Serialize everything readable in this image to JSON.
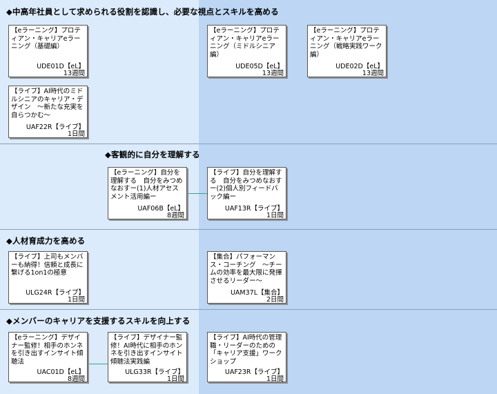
{
  "sections": [
    {
      "title": "◆中高年社員として求められる役割を認識し、必要な視点とスキルを高める",
      "courses": [
        {
          "title": "【eラーニング】プロティアン・キャリアeラーニング（基礎編）",
          "code": "UDE01D【eL】",
          "duration": "13週間"
        },
        {
          "title": "【eラーニング】プロティアン・キャリアeラーニング（ミドルシニア編）",
          "code": "UDE05D【eL】",
          "duration": "13週間"
        },
        {
          "title": "【eラーニング】プロティアン・キャリアeラーニング（戦略実践ワーク編）",
          "code": "UDE02D【eL】",
          "duration": "13週間"
        },
        {
          "title": "【ライブ】AI時代のミドルシニアのキャリア・デザイン　～新たな充実を自らつかむ～",
          "code": "UAF22R【ライブ】",
          "duration": "1日間"
        }
      ]
    },
    {
      "title": "◆客観的に自分を理解する",
      "courses": [
        {
          "title": "【eラーニング】自分を理解する　自分をみつめなおすー(1)人材アセスメント活用編ー",
          "code": "UAF06B【eL】",
          "duration": "8週間"
        },
        {
          "title": "【ライブ】自分を理解する　自分をみつめなおすー(2)個人別フィードバック編ー",
          "code": "UAF13R【ライブ】",
          "duration": "1日間"
        }
      ]
    },
    {
      "title": "◆人材育成力を高める",
      "courses": [
        {
          "title": "【ライブ】上司もメンバーも納得！信頼と成長に繋げる1on1の極意",
          "code": "ULG24R【ライブ】",
          "duration": "1日間"
        },
        {
          "title": "【集合】パフォーマンス・コーチング　～チームの効率を最大限に発揮させるリーダー～",
          "code": "UAM37L【集合】",
          "duration": "2日間"
        }
      ]
    },
    {
      "title": "◆メンバーのキャリアを支援するスキルを向上する",
      "courses": [
        {
          "title": "【eラーニング】デザイナー監修！相手のホンネを引き出すインサイト傾聴法",
          "code": "UAC01D【eL】",
          "duration": "8週間"
        },
        {
          "title": "【ライブ】デザイナー監修！AI時代に相手のホンネを引き出すインサイト傾聴法実践編",
          "code": "ULG33R【ライブ】",
          "duration": "1日間"
        },
        {
          "title": "【ライブ】AI時代の管理職・リーダーのための「キャリア支援」ワークショップ",
          "code": "UAF23R【ライブ】",
          "duration": "1日間"
        }
      ]
    }
  ]
}
